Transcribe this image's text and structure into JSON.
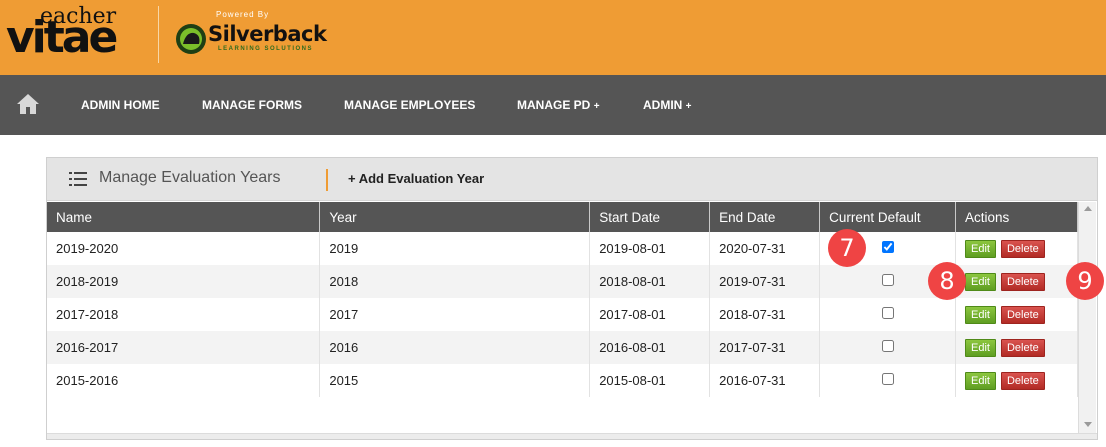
{
  "brand": {
    "logo_main": "vitae",
    "logo_small": "eacher",
    "powered_by": "Powered By",
    "partner_name": "Silverback",
    "partner_sub": "LEARNING SOLUTIONS"
  },
  "nav": {
    "home_icon": "home-icon",
    "items": [
      {
        "label": "ADMIN HOME"
      },
      {
        "label": "MANAGE FORMS"
      },
      {
        "label": "MANAGE EMPLOYEES"
      },
      {
        "label": "MANAGE PD",
        "suffix": "+"
      },
      {
        "label": "ADMIN",
        "suffix": "+"
      }
    ]
  },
  "panel": {
    "title": "Manage Evaluation Years",
    "add_label": "+ Add Evaluation Year"
  },
  "table": {
    "headers": [
      "Name",
      "Year",
      "Start Date",
      "End Date",
      "Current Default",
      "Actions"
    ],
    "rows": [
      {
        "name": "2019-2020",
        "year": "2019",
        "start": "2019-08-01",
        "end": "2020-07-31",
        "default": true
      },
      {
        "name": "2018-2019",
        "year": "2018",
        "start": "2018-08-01",
        "end": "2019-07-31",
        "default": false
      },
      {
        "name": "2017-2018",
        "year": "2017",
        "start": "2017-08-01",
        "end": "2018-07-31",
        "default": false
      },
      {
        "name": "2016-2017",
        "year": "2016",
        "start": "2016-08-01",
        "end": "2017-07-31",
        "default": false
      },
      {
        "name": "2015-2016",
        "year": "2015",
        "start": "2015-08-01",
        "end": "2016-07-31",
        "default": false
      }
    ],
    "edit_label": "Edit",
    "delete_label": "Delete"
  },
  "badges": [
    "7",
    "8",
    "9"
  ],
  "colors": {
    "header_bg": "#ef9c34",
    "nav_bg": "#555555",
    "edit_green": "#6aa82a",
    "delete_red": "#c0392b",
    "badge_red": "#ef4444"
  }
}
